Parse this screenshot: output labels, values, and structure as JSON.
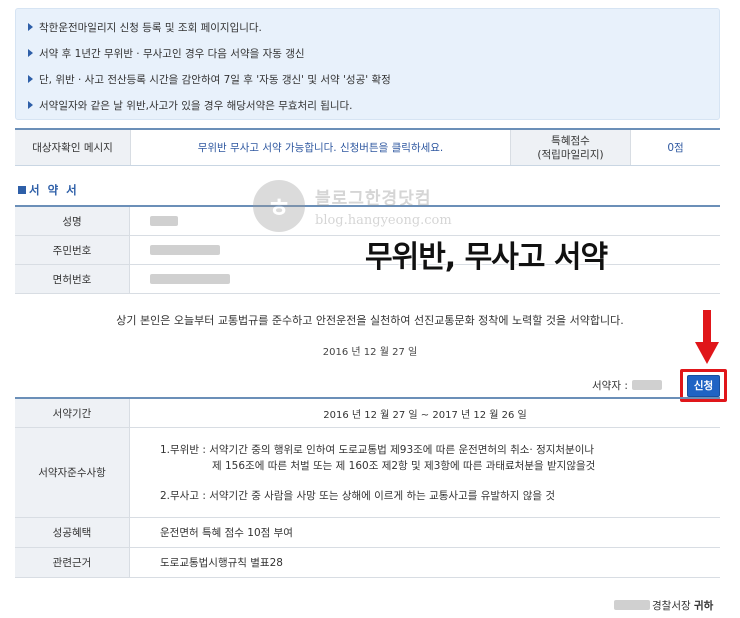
{
  "notices": [
    "착한운전마일리지 신청 등록 및 조회 페이지입니다.",
    "서약 후 1년간 무위반 · 무사고인 경우 다음 서약을 자동 갱신",
    "단, 위반 · 사고 전산등록 시간을 감안하여 7일 후 '자동 갱신' 및 서약 '성공' 확정",
    "서약일자와 같은 날 위반,사고가 있을 경우 해당서약은 무효처리 됩니다."
  ],
  "status": {
    "check_label": "대상자확인 메시지",
    "check_message": "무위반 무사고 서약 가능합니다. 신청버튼을 클릭하세요.",
    "points_label_line1": "특혜점수",
    "points_label_line2": "(적립마일리지)",
    "points_value": "0점"
  },
  "section_title": "서 약 서",
  "info": {
    "name_label": "성명",
    "id_label": "주민번호",
    "license_label": "면허번호"
  },
  "watermark": {
    "title": "블로그한경닷컴",
    "url": "blog.hangyeong.com"
  },
  "overlay_title": "무위반, 무사고 서약",
  "pledge_text": "상기 본인은 오늘부터 교통법규를 준수하고 안전운전을 실천하여 선진교통문화 정착에 노력할 것을 서약합니다.",
  "pledge_date": "2016 년 12 월 27 일",
  "signer_label": "서약자 :",
  "apply_button": "신청",
  "accent_color": "#1f63c4",
  "highlight_color": "#e0161a",
  "pledge_table": {
    "period_label": "서약기간",
    "period_value": "2016 년 12 월 27 일 ~ 2017 년 12 월 26 일",
    "rules_label": "서약자준수사항",
    "rule1_line1": "1.무위반 : 서약기간 중의 행위로 인하여 도로교통법 제93조에 따른 운전면허의 취소· 정지처분이나",
    "rule1_line2": "제 156조에 따른 처벌 또는 제 160조 제2항 및 제3항에 따른 과태료처분을 받지않을것",
    "rule2": "2.무사고 : 서약기간 중 사람을 사망 또는 상해에 이르게 하는 교통사고를 유발하지 않을 것",
    "benefit_label": "성공혜택",
    "benefit_value": "운전면허 특혜 점수 10점 부여",
    "basis_label": "관련근거",
    "basis_value": "도로교통법시행규칙 별표28"
  },
  "footer": {
    "suffix": "경찰서장",
    "honorific": "귀하"
  }
}
